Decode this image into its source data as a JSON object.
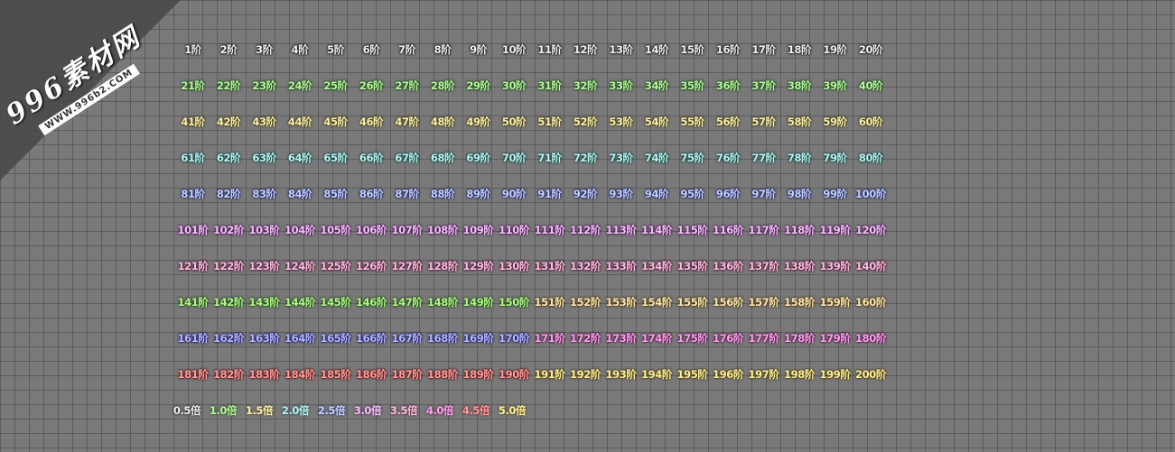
{
  "watermark": {
    "big": "996素材网",
    "small": "WWW.996b2.COM"
  },
  "colors": {
    "background": "#7a797a",
    "tier_1_20": "#f2f2f2",
    "tier_21_40": "#b9f7a0",
    "tier_41_60": "#f8f0b0",
    "tier_61_80": "#bdf3ef",
    "tier_81_100": "#c9d2ff",
    "tier_101_120": "#f1c6f6",
    "tier_121_140": "#f7c3dc",
    "tier_141_150": "#b4f78d",
    "tier_151_160": "#fbe7b3",
    "tier_161_170": "#b7b9ff",
    "tier_171_180": "#f6a6e6",
    "tier_181_190": "#ff9f9f",
    "tier_191_200": "#fff09a"
  },
  "tiers": [
    [
      "1阶",
      "2阶",
      "3阶",
      "4阶",
      "5阶",
      "6阶",
      "7阶",
      "8阶",
      "9阶",
      "10阶",
      "11阶",
      "12阶",
      "13阶",
      "14阶",
      "15阶",
      "16阶",
      "17阶",
      "18阶",
      "19阶",
      "20阶"
    ],
    [
      "21阶",
      "22阶",
      "23阶",
      "24阶",
      "25阶",
      "26阶",
      "27阶",
      "28阶",
      "29阶",
      "30阶",
      "31阶",
      "32阶",
      "33阶",
      "34阶",
      "35阶",
      "36阶",
      "37阶",
      "38阶",
      "39阶",
      "40阶"
    ],
    [
      "41阶",
      "42阶",
      "43阶",
      "44阶",
      "45阶",
      "46阶",
      "47阶",
      "48阶",
      "49阶",
      "50阶",
      "51阶",
      "52阶",
      "53阶",
      "54阶",
      "55阶",
      "56阶",
      "57阶",
      "58阶",
      "59阶",
      "60阶"
    ],
    [
      "61阶",
      "62阶",
      "63阶",
      "64阶",
      "65阶",
      "66阶",
      "67阶",
      "68阶",
      "69阶",
      "70阶",
      "71阶",
      "72阶",
      "73阶",
      "74阶",
      "75阶",
      "76阶",
      "77阶",
      "78阶",
      "79阶",
      "80阶"
    ],
    [
      "81阶",
      "82阶",
      "83阶",
      "84阶",
      "85阶",
      "86阶",
      "87阶",
      "88阶",
      "89阶",
      "90阶",
      "91阶",
      "92阶",
      "93阶",
      "94阶",
      "95阶",
      "96阶",
      "97阶",
      "98阶",
      "99阶",
      "100阶"
    ],
    [
      "101阶",
      "102阶",
      "103阶",
      "104阶",
      "105阶",
      "106阶",
      "107阶",
      "108阶",
      "109阶",
      "110阶",
      "111阶",
      "112阶",
      "113阶",
      "114阶",
      "115阶",
      "116阶",
      "117阶",
      "118阶",
      "119阶",
      "120阶"
    ],
    [
      "121阶",
      "122阶",
      "123阶",
      "124阶",
      "125阶",
      "126阶",
      "127阶",
      "128阶",
      "129阶",
      "130阶",
      "131阶",
      "132阶",
      "133阶",
      "134阶",
      "135阶",
      "136阶",
      "137阶",
      "138阶",
      "139阶",
      "140阶"
    ],
    [
      "141阶",
      "142阶",
      "143阶",
      "144阶",
      "145阶",
      "146阶",
      "147阶",
      "148阶",
      "149阶",
      "150阶",
      "151阶",
      "152阶",
      "153阶",
      "154阶",
      "155阶",
      "156阶",
      "157阶",
      "158阶",
      "159阶",
      "160阶"
    ],
    [
      "161阶",
      "162阶",
      "163阶",
      "164阶",
      "165阶",
      "166阶",
      "167阶",
      "168阶",
      "169阶",
      "170阶",
      "171阶",
      "172阶",
      "173阶",
      "174阶",
      "175阶",
      "176阶",
      "177阶",
      "178阶",
      "179阶",
      "180阶"
    ],
    [
      "181阶",
      "182阶",
      "183阶",
      "184阶",
      "185阶",
      "186阶",
      "187阶",
      "188阶",
      "189阶",
      "190阶",
      "191阶",
      "192阶",
      "193阶",
      "194阶",
      "195阶",
      "196阶",
      "197阶",
      "198阶",
      "199阶",
      "200阶"
    ]
  ],
  "multipliers": [
    "0.5倍",
    "1.0倍",
    "1.5倍",
    "2.0倍",
    "2.5倍",
    "3.0倍",
    "3.5倍",
    "4.0倍",
    "4.5倍",
    "5.0倍"
  ]
}
